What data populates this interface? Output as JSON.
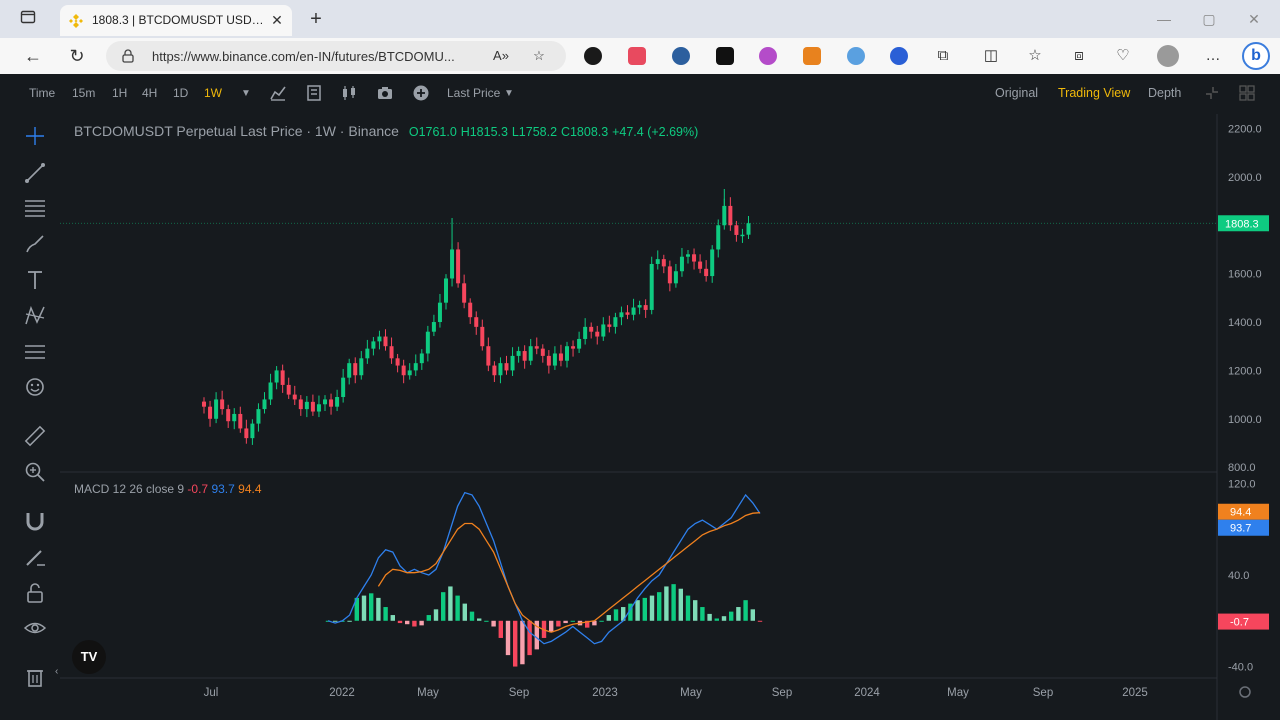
{
  "browser": {
    "tab_title": "1808.3 | BTCDOMUSDT USD⊙-M",
    "url": "https://www.binance.com/en-IN/futures/BTCDOMU...",
    "url_host": "binance.com",
    "icons": [
      "sidebar-icon",
      "binance-favicon",
      "close-icon",
      "plus-icon",
      "back-icon",
      "reload-icon",
      "lock-icon",
      "read-aloud-icon",
      "favorite-icon"
    ],
    "extensions": [
      "vpn-ext",
      "red-ext",
      "v-ext",
      "dark-ext",
      "purple-ext",
      "metamask-ext",
      "swirl-ext",
      "blue-ring-ext",
      "puzzle-icon",
      "split-screen-icon",
      "favorites-icon",
      "collections-icon",
      "heart-icon",
      "profile-avatar",
      "more-icon",
      "bing-icon"
    ]
  },
  "chart_toolbar": {
    "items": [
      {
        "label": "Time",
        "active": false
      },
      {
        "label": "15m",
        "active": false
      },
      {
        "label": "1H",
        "active": false
      },
      {
        "label": "4H",
        "active": false
      },
      {
        "label": "1D",
        "active": false
      },
      {
        "label": "1W",
        "active": true
      }
    ],
    "price_type": "Last Price",
    "views": [
      {
        "label": "Original",
        "active": false
      },
      {
        "label": "Trading View",
        "active": true
      },
      {
        "label": "Depth",
        "active": false
      }
    ]
  },
  "legend": {
    "title": "BTCDOMUSDT Perpetual Last Price · 1W · Binance",
    "open": "O1761.0",
    "high": "H1815.3",
    "low": "L1758.2",
    "close": "C1808.3",
    "change": "+47.4 (+2.69%)"
  },
  "macd_legend": {
    "label": "MACD 12 26 close 9",
    "hist": "-0.7",
    "macd": "93.7",
    "signal": "94.4"
  },
  "colors": {
    "up": "#0ecb81",
    "down": "#f6465d",
    "macd_line": "#2f80ed",
    "signal_line": "#f0811e",
    "accent": "#f0b90b",
    "background": "#161a1e"
  },
  "chart_data": {
    "type": "candlestick",
    "price_axis": {
      "ticks": [
        "2200.0",
        "2000.0",
        "1800.0",
        "1600.0",
        "1400.0",
        "1200.0",
        "1000.0",
        "800.0"
      ],
      "ylim": [
        780,
        2260
      ]
    },
    "last_price_label": "1808.3",
    "last_price": 1808.3,
    "x_axis_labels": [
      "Jul",
      "2022",
      "May",
      "Sep",
      "2023",
      "May",
      "Sep",
      "2024",
      "May",
      "Sep",
      "2025"
    ],
    "candles_close_series": [
      1050,
      1000,
      1080,
      1040,
      990,
      1020,
      960,
      920,
      980,
      1040,
      1080,
      1150,
      1200,
      1140,
      1100,
      1080,
      1040,
      1070,
      1030,
      1060,
      1080,
      1050,
      1090,
      1170,
      1230,
      1180,
      1250,
      1290,
      1320,
      1340,
      1300,
      1250,
      1220,
      1180,
      1200,
      1230,
      1270,
      1360,
      1400,
      1480,
      1580,
      1700,
      1560,
      1480,
      1420,
      1380,
      1300,
      1220,
      1180,
      1230,
      1200,
      1260,
      1280,
      1240,
      1300,
      1290,
      1260,
      1220,
      1270,
      1240,
      1300,
      1290,
      1330,
      1380,
      1360,
      1340,
      1390,
      1380,
      1420,
      1440,
      1430,
      1460,
      1470,
      1450,
      1640,
      1660,
      1630,
      1560,
      1610,
      1670,
      1680,
      1650,
      1620,
      1590,
      1700,
      1800,
      1880,
      1800,
      1760,
      1761,
      1808.3
    ],
    "macd_axis": {
      "ticks": [
        "120.0",
        "80.0",
        "40.0",
        "-40.0"
      ],
      "ylim": [
        -50,
        130
      ]
    },
    "macd_labels": {
      "signal": "94.4",
      "macd": "93.7",
      "hist": "-0.7"
    },
    "macd_values": {
      "signal": 94.4,
      "macd": 93.7,
      "hist": -0.7
    },
    "macd_series": [
      0,
      -2,
      0,
      5,
      20,
      30,
      40,
      55,
      62,
      60,
      48,
      42,
      45,
      42,
      40,
      45,
      60,
      80,
      100,
      112,
      110,
      100,
      85,
      70,
      50,
      30,
      15,
      0,
      -10,
      -15,
      -20,
      -18,
      -14,
      -10,
      -5,
      -10,
      -15,
      -20,
      -18,
      -10,
      -5,
      0,
      10,
      20,
      28,
      35,
      40,
      50,
      60,
      70,
      80,
      85,
      88,
      84,
      80,
      85,
      90,
      100,
      110,
      103,
      93.7
    ],
    "signal_series": [
      null,
      null,
      null,
      null,
      null,
      null,
      null,
      30,
      40,
      45,
      44,
      42,
      42,
      43,
      45,
      50,
      60,
      70,
      80,
      85,
      85,
      80,
      70,
      60,
      45,
      30,
      15,
      5,
      0,
      -5,
      -8,
      -10,
      -8,
      -5,
      -3,
      -2,
      -1,
      0,
      5,
      10,
      15,
      20,
      25,
      30,
      35,
      40,
      45,
      50,
      55,
      60,
      65,
      70,
      75,
      78,
      80,
      83,
      85,
      88,
      92,
      94,
      94.4
    ],
    "hist_series": [
      0,
      0,
      0,
      0,
      20,
      22,
      24,
      20,
      12,
      5,
      -2,
      -3,
      -5,
      -4,
      5,
      10,
      25,
      30,
      22,
      15,
      8,
      2,
      0,
      -5,
      -15,
      -30,
      -40,
      -38,
      -30,
      -25,
      -15,
      -10,
      -5,
      -2,
      0,
      -4,
      -6,
      -4,
      0,
      5,
      10,
      12,
      15,
      18,
      20,
      22,
      25,
      30,
      32,
      28,
      22,
      18,
      12,
      6,
      2,
      4,
      8,
      12,
      18,
      10,
      -0.7
    ]
  }
}
